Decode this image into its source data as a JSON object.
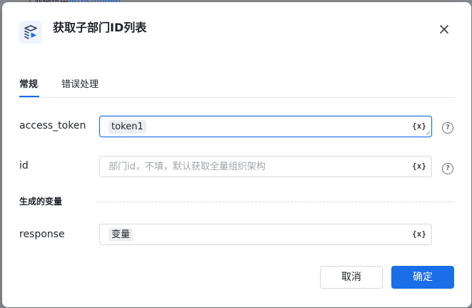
{
  "background": {
    "text": "工业微信由",
    "link": "https://open..."
  },
  "dialog": {
    "title": "获取子部门ID列表",
    "app_icon": "workflow-box-icon",
    "close_icon": "close-icon"
  },
  "tabs": [
    {
      "label": "常规",
      "active": true
    },
    {
      "label": "错误处理",
      "active": false
    }
  ],
  "fields": {
    "access_token": {
      "label": "access_token",
      "value": "token1",
      "var_button": "{x}"
    },
    "id": {
      "label": "id",
      "placeholder": "部门id，不填，默认获取全量组织架构",
      "var_button": "{x}"
    }
  },
  "output_section": {
    "label": "生成的变量",
    "response": {
      "label": "response",
      "value": "变量",
      "var_button": "{x}"
    }
  },
  "help_icon_text": "?",
  "buttons": {
    "cancel": "取消",
    "ok": "确定"
  },
  "colors": {
    "accent": "#1a6ee8",
    "overlay": "#8a8d92"
  }
}
